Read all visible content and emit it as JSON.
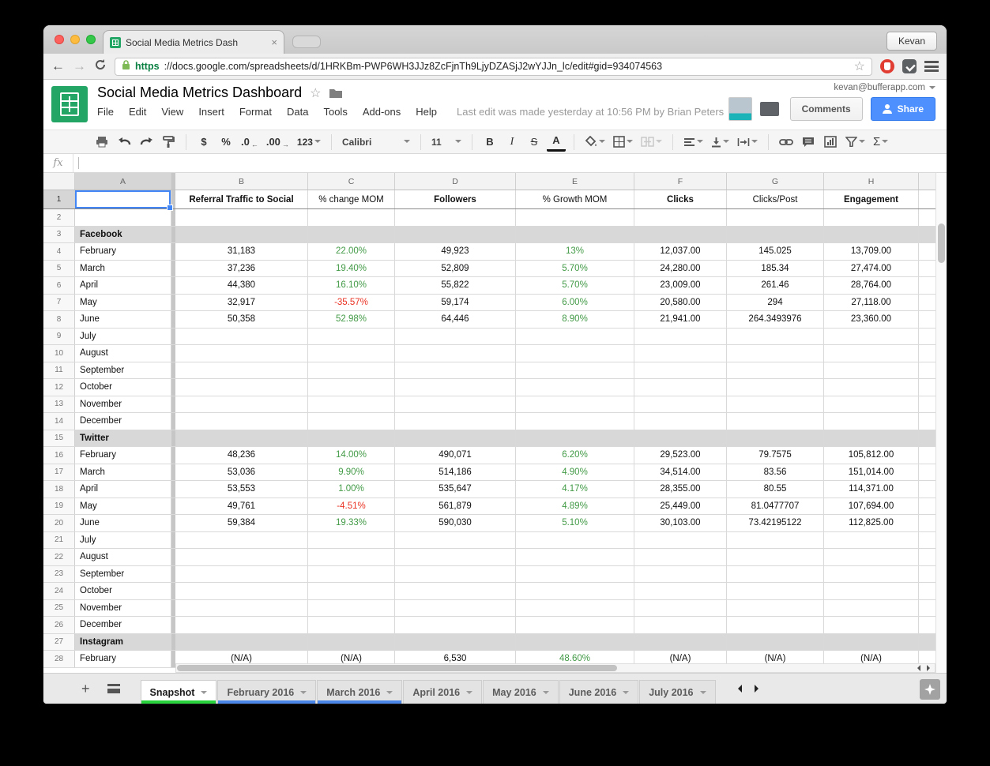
{
  "browser": {
    "tab_title": "Social Media Metrics Dash",
    "close_glyph": "×",
    "user_button": "Kevan",
    "back_glyph": "←",
    "forward_glyph": "→",
    "reload_glyph": "C",
    "url_scheme": "https",
    "url_rest": "://docs.google.com/spreadsheets/d/1HRKBm-PWP6WH3JJz8ZcFjnTh9LjyDZASjJ2wYJJn_lc/edit#gid=934074563",
    "star_glyph": "☆"
  },
  "header": {
    "title": "Social Media Metrics Dashboard",
    "star_glyph": "☆",
    "menus": [
      "File",
      "Edit",
      "View",
      "Insert",
      "Format",
      "Data",
      "Tools",
      "Add-ons",
      "Help"
    ],
    "last_edit": "Last edit was made yesterday at 10:56 PM by Brian Peters",
    "account_email": "kevan@bufferapp.com",
    "comments_label": "Comments",
    "share_label": "Share"
  },
  "toolbar": {
    "currency": "$",
    "percent": "%",
    "dec_less": ".0",
    "dec_less_arrow": "←",
    "dec_more": ".00",
    "dec_more_arrow": "→",
    "more_formats": "123",
    "font_name": "Calibri",
    "font_size": "11",
    "bold_glyph": "B",
    "italic_glyph": "I",
    "strike_glyph": "S",
    "text_color_glyph": "A",
    "functions_glyph": "Σ"
  },
  "formula_bar": {
    "fx_label": "fx",
    "value": ""
  },
  "grid": {
    "column_letters": [
      "A",
      "B",
      "C",
      "D",
      "E",
      "F",
      "G",
      "H"
    ],
    "selected_cell": "A1",
    "rows": [
      {
        "n": "1",
        "type": "colheads",
        "cells": [
          "",
          "Referral Traffic to Social",
          "% change MOM",
          "Followers",
          "% Growth MOM",
          "Clicks",
          "Clicks/Post",
          "Engagement"
        ]
      },
      {
        "n": "2",
        "type": "empty",
        "cells": [
          "",
          "",
          "",
          "",
          "",
          "",
          "",
          ""
        ]
      },
      {
        "n": "3",
        "type": "section",
        "cells": [
          "Facebook",
          "",
          "",
          "",
          "",
          "",
          "",
          ""
        ]
      },
      {
        "n": "4",
        "type": "data",
        "cells": [
          "February",
          "31,183",
          "22.00%",
          "49,923",
          "13%",
          "12,037.00",
          "145.025",
          "13,709.00"
        ]
      },
      {
        "n": "5",
        "type": "data",
        "cells": [
          "March",
          "37,236",
          "19.40%",
          "52,809",
          "5.70%",
          "24,280.00",
          "185.34",
          "27,474.00"
        ]
      },
      {
        "n": "6",
        "type": "data",
        "cells": [
          "April",
          "44,380",
          "16.10%",
          "55,822",
          "5.70%",
          "23,009.00",
          "261.46",
          "28,764.00"
        ]
      },
      {
        "n": "7",
        "type": "data",
        "cells": [
          "May",
          "32,917",
          "-35.57%",
          "59,174",
          "6.00%",
          "20,580.00",
          "294",
          "27,118.00"
        ]
      },
      {
        "n": "8",
        "type": "data",
        "cells": [
          "June",
          "50,358",
          "52.98%",
          "64,446",
          "8.90%",
          "21,941.00",
          "264.3493976",
          "23,360.00"
        ]
      },
      {
        "n": "9",
        "type": "data",
        "cells": [
          "July",
          "",
          "",
          "",
          "",
          "",
          "",
          ""
        ]
      },
      {
        "n": "10",
        "type": "data",
        "cells": [
          "August",
          "",
          "",
          "",
          "",
          "",
          "",
          ""
        ]
      },
      {
        "n": "11",
        "type": "data",
        "cells": [
          "September",
          "",
          "",
          "",
          "",
          "",
          "",
          ""
        ]
      },
      {
        "n": "12",
        "type": "data",
        "cells": [
          "October",
          "",
          "",
          "",
          "",
          "",
          "",
          ""
        ]
      },
      {
        "n": "13",
        "type": "data",
        "cells": [
          "November",
          "",
          "",
          "",
          "",
          "",
          "",
          ""
        ]
      },
      {
        "n": "14",
        "type": "data",
        "cells": [
          "December",
          "",
          "",
          "",
          "",
          "",
          "",
          ""
        ]
      },
      {
        "n": "15",
        "type": "section",
        "cells": [
          "Twitter",
          "",
          "",
          "",
          "",
          "",
          "",
          ""
        ]
      },
      {
        "n": "16",
        "type": "data",
        "cells": [
          "February",
          "48,236",
          "14.00%",
          "490,071",
          "6.20%",
          "29,523.00",
          "79.7575",
          "105,812.00"
        ]
      },
      {
        "n": "17",
        "type": "data",
        "cells": [
          "March",
          "53,036",
          "9.90%",
          "514,186",
          "4.90%",
          "34,514.00",
          "83.56",
          "151,014.00"
        ]
      },
      {
        "n": "18",
        "type": "data",
        "cells": [
          "April",
          "53,553",
          "1.00%",
          "535,647",
          "4.17%",
          "28,355.00",
          "80.55",
          "114,371.00"
        ]
      },
      {
        "n": "19",
        "type": "data",
        "cells": [
          "May",
          "49,761",
          "-4.51%",
          "561,879",
          "4.89%",
          "25,449.00",
          "81.0477707",
          "107,694.00"
        ]
      },
      {
        "n": "20",
        "type": "data",
        "cells": [
          "June",
          "59,384",
          "19.33%",
          "590,030",
          "5.10%",
          "30,103.00",
          "73.42195122",
          "112,825.00"
        ]
      },
      {
        "n": "21",
        "type": "data",
        "cells": [
          "July",
          "",
          "",
          "",
          "",
          "",
          "",
          ""
        ]
      },
      {
        "n": "22",
        "type": "data",
        "cells": [
          "August",
          "",
          "",
          "",
          "",
          "",
          "",
          ""
        ]
      },
      {
        "n": "23",
        "type": "data",
        "cells": [
          "September",
          "",
          "",
          "",
          "",
          "",
          "",
          ""
        ]
      },
      {
        "n": "24",
        "type": "data",
        "cells": [
          "October",
          "",
          "",
          "",
          "",
          "",
          "",
          ""
        ]
      },
      {
        "n": "25",
        "type": "data",
        "cells": [
          "November",
          "",
          "",
          "",
          "",
          "",
          "",
          ""
        ]
      },
      {
        "n": "26",
        "type": "data",
        "cells": [
          "December",
          "",
          "",
          "",
          "",
          "",
          "",
          ""
        ]
      },
      {
        "n": "27",
        "type": "section",
        "cells": [
          "Instagram",
          "",
          "",
          "",
          "",
          "",
          "",
          ""
        ]
      },
      {
        "n": "28",
        "type": "data",
        "cells": [
          "February",
          "(N/A)",
          "(N/A)",
          "6,530",
          "48.60%",
          "(N/A)",
          "(N/A)",
          "(N/A)"
        ]
      }
    ]
  },
  "sheet_tabs": {
    "add_glyph": "+",
    "tabs": [
      {
        "label": "Snapshot",
        "state": "active"
      },
      {
        "label": "February 2016",
        "state": "blue"
      },
      {
        "label": "March 2016",
        "state": "blue"
      },
      {
        "label": "April 2016",
        "state": "plain"
      },
      {
        "label": "May 2016",
        "state": "plain"
      },
      {
        "label": "June 2016",
        "state": "plain"
      },
      {
        "label": "July 2016",
        "state": "plain"
      }
    ]
  },
  "colors": {
    "positive_percent": "#429a46",
    "negative_percent": "#ea3323",
    "section_row_bg": "#d8d8d8",
    "share_button": "#4d90fe",
    "sheets_green": "#23a566",
    "active_tab_underline": "#28d23c",
    "linked_tab_underline": "#4a86e8",
    "selection_blue": "#4285f4"
  }
}
